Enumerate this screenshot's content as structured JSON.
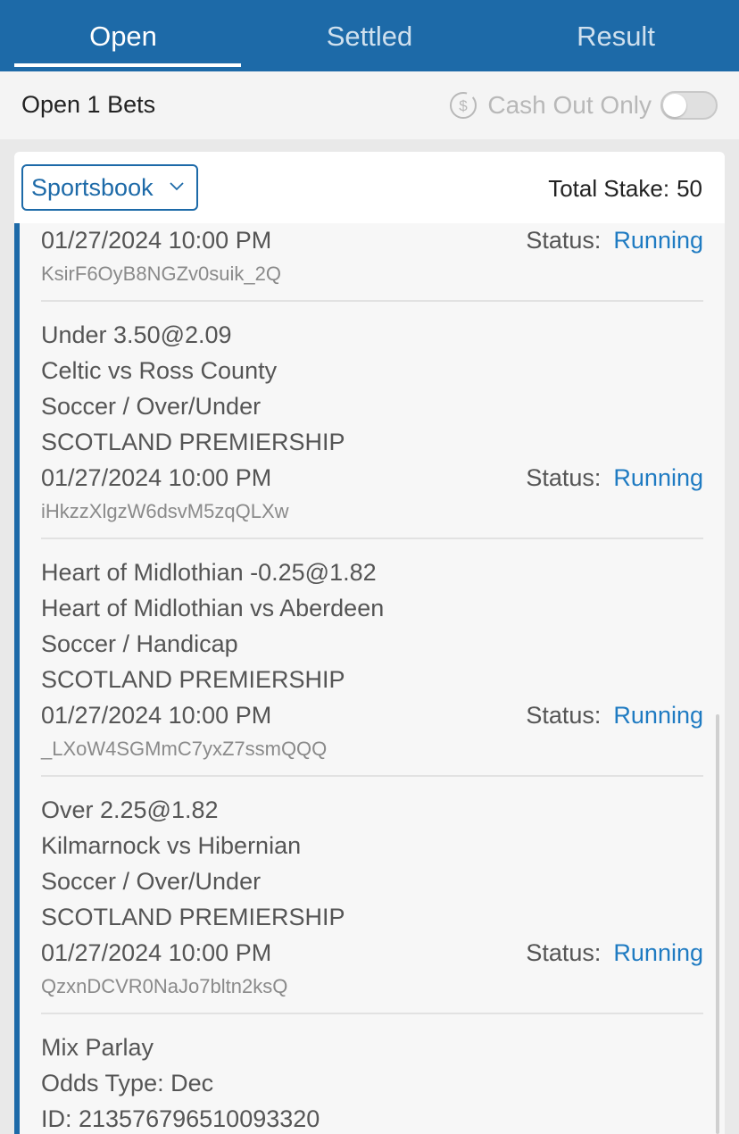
{
  "tabs": [
    {
      "label": "Open",
      "active": true
    },
    {
      "label": "Settled",
      "active": false
    },
    {
      "label": "Result",
      "active": false
    }
  ],
  "subheader": {
    "open_count": "Open 1 Bets",
    "cashout_label": "Cash Out Only",
    "cashout_icon": "dollar-circle-icon",
    "cashout_enabled": false
  },
  "filter": {
    "dropdown_value": "Sportsbook",
    "total_stake_label": "Total Stake:",
    "total_stake_value": "50"
  },
  "status_label": "Status:",
  "bets": [
    {
      "date": "01/27/2024 10:00 PM",
      "id": "KsirF6OyB8NGZv0suik_2Q",
      "status": "Running"
    },
    {
      "selection": "Under 3.50@2.09",
      "match": "Celtic vs Ross County",
      "market": "Soccer / Over/Under",
      "league": "SCOTLAND PREMIERSHIP",
      "date": "01/27/2024 10:00 PM",
      "id": "iHkzzXlgzW6dsvM5zqQLXw",
      "status": "Running"
    },
    {
      "selection": "Heart of Midlothian -0.25@1.82",
      "match": "Heart of Midlothian vs Aberdeen",
      "market": "Soccer / Handicap",
      "league": "SCOTLAND PREMIERSHIP",
      "date": "01/27/2024 10:00 PM",
      "id": "_LXoW4SGMmC7yxZ7ssmQQQ",
      "status": "Running"
    },
    {
      "selection": "Over 2.25@1.82",
      "match": "Kilmarnock vs Hibernian",
      "market": "Soccer / Over/Under",
      "league": "SCOTLAND PREMIERSHIP",
      "date": "01/27/2024 10:00 PM",
      "id": "QzxnDCVR0NaJo7bltn2ksQ",
      "status": "Running"
    }
  ],
  "parlay": {
    "title": "Mix Parlay",
    "odds_type": "Odds Type: Dec",
    "id": "ID: 213576796510093320"
  },
  "colors": {
    "primary": "#1d6aa8",
    "status_running": "#1f7bc2"
  }
}
